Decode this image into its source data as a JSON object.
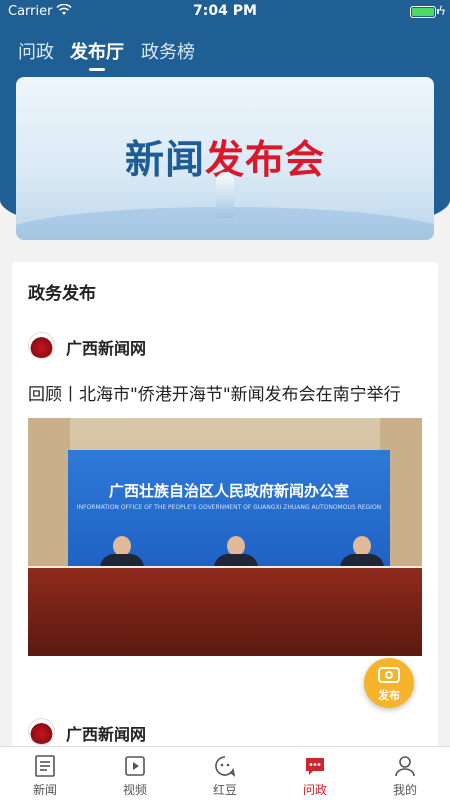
{
  "status_bar": {
    "carrier": "Carrier",
    "time": "7:04 PM"
  },
  "top_tabs": [
    {
      "label": "问政",
      "active": false
    },
    {
      "label": "发布厅",
      "active": true
    },
    {
      "label": "政务榜",
      "active": false
    }
  ],
  "banner": {
    "title_part1": "新闻",
    "title_part2": "发布会"
  },
  "section": {
    "title": "政务发布"
  },
  "articles": [
    {
      "source": "广西新闻网",
      "title": "回顾丨北海市\"侨港开海节\"新闻发布会在南宁举行",
      "image": {
        "screen_text": "广西壮族自治区人民政府新闻办公室",
        "screen_subtext": "INFORMATION OFFICE OF THE PEOPLE'S GOVERNMENT OF GUANGXI ZHUANG AUTONOMOUS REGION"
      }
    },
    {
      "source": "广西新闻网"
    }
  ],
  "publish_button": {
    "label": "发布"
  },
  "bottom_tabs": [
    {
      "label": "新闻",
      "icon": "news-icon",
      "active": false
    },
    {
      "label": "视频",
      "icon": "video-icon",
      "active": false
    },
    {
      "label": "红豆",
      "icon": "chat-bean-icon",
      "active": false
    },
    {
      "label": "问政",
      "icon": "message-icon",
      "active": true
    },
    {
      "label": "我的",
      "icon": "profile-icon",
      "active": false
    }
  ],
  "colors": {
    "header_blue": "#1f5f93",
    "accent_red": "#d0242f",
    "fab_yellow": "#f5b42a"
  }
}
